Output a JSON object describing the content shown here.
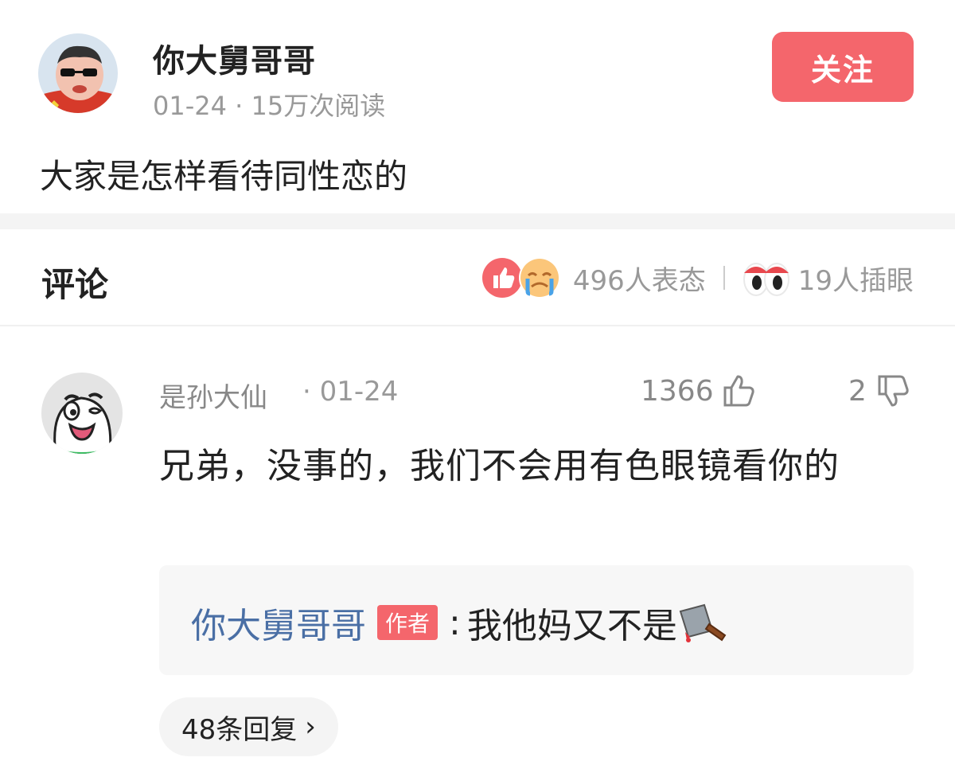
{
  "post": {
    "author": "你大舅哥哥",
    "date": "01-24",
    "meta_sep": " · ",
    "reads": "15万次阅读",
    "follow_label": "关注",
    "text": "大家是怎样看待同性恋的"
  },
  "comments_header": {
    "title": "评论",
    "reactions_label": "496人表态",
    "eye_label": "19人插眼"
  },
  "comment": {
    "user": "是孙大仙",
    "date": "· 01-24",
    "likes": "1366",
    "dislikes": "2",
    "text": "兄弟，没事的，我们不会用有色眼镜看你的",
    "reply": {
      "author": "你大舅哥哥",
      "tag": "作者",
      "sep": ":",
      "text": "我他妈又不是"
    },
    "replies_label": "48条回复"
  },
  "colors": {
    "accent": "#f4666c",
    "link": "#4a6fa5",
    "muted": "#999999"
  }
}
